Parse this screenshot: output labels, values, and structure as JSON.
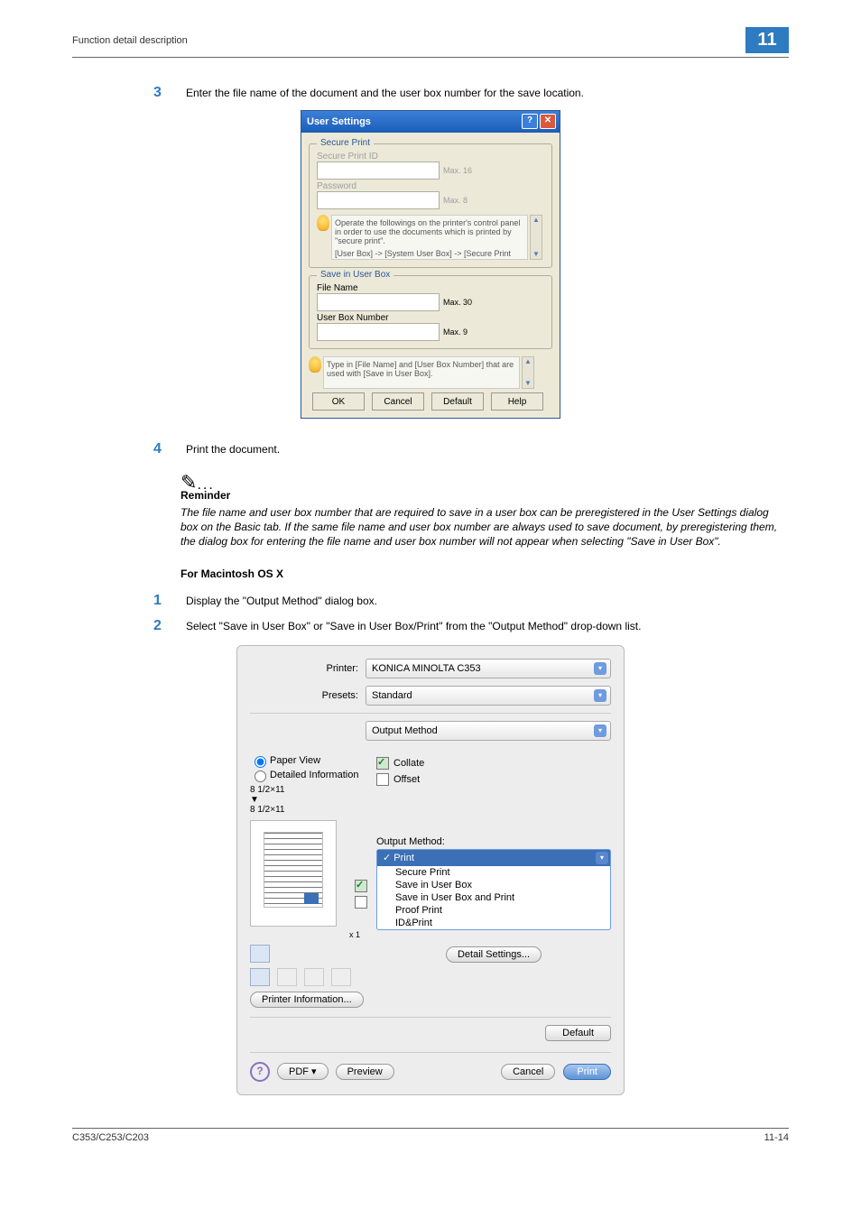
{
  "header": {
    "title": "Function detail description",
    "chapter": "11"
  },
  "steps": {
    "s3": {
      "num": "3",
      "text": "Enter the file name of the document and the user box number for the save location."
    },
    "s4": {
      "num": "4",
      "text": "Print the document."
    },
    "m1": {
      "num": "1",
      "text": "Display the \"Output Method\" dialog box."
    },
    "m2": {
      "num": "2",
      "text": "Select \"Save in User Box\" or \"Save in User Box/Print\" from the \"Output Method\" drop-down list."
    }
  },
  "win_dialog": {
    "title": "User Settings",
    "secure_group": "Secure Print",
    "secure_id_label": "Secure Print ID",
    "secure_id_hint": "Max. 16",
    "password_label": "Password",
    "password_hint": "Max. 8",
    "info1_line1": "Operate the followings on the printer's control panel in order to use the documents which is printed by \"secure print\".",
    "info1_line2": "[User Box] -> [System User Box] -> [Secure Print",
    "save_group": "Save in User Box",
    "file_name_label": "File Name",
    "file_name_hint": "Max. 30",
    "box_num_label": "User Box Number",
    "box_num_hint": "Max. 9",
    "info2": "Type in [File Name] and [User Box Number] that are used with [Save in User Box].",
    "buttons": {
      "ok": "OK",
      "cancel": "Cancel",
      "default": "Default",
      "help": "Help"
    }
  },
  "reminder": {
    "heading": "Reminder",
    "body": "The file name and user box number that are required to save in a user box can be preregistered in the User Settings dialog box on the Basic tab. If the same file name and user box number are always used to save document, by preregistering them, the dialog box for entering the file name and user box number will not appear when selecting \"Save in User Box\"."
  },
  "mac_heading": "For Macintosh OS X",
  "mac": {
    "printer_label": "Printer:",
    "printer_value": "KONICA MINOLTA C353",
    "presets_label": "Presets:",
    "presets_value": "Standard",
    "panel_value": "Output Method",
    "paper_view": "Paper View",
    "detailed_info": "Detailed Information",
    "paper_size_a": "8 1/2×11",
    "paper_size_b": "8 1/2×11",
    "x_label": "x 1",
    "collate": "Collate",
    "offset": "Offset",
    "output_method_label": "Output Method:",
    "dd_selected": "Print",
    "dd_items": [
      "Secure Print",
      "Save in User Box",
      "Save in User Box and Print",
      "Proof Print",
      "ID&Print"
    ],
    "printer_info_btn": "Printer Information...",
    "detail_btn": "Detail Settings...",
    "default_btn": "Default",
    "pdf_btn": "PDF ▾",
    "preview_btn": "Preview",
    "cancel_btn": "Cancel",
    "print_btn": "Print"
  },
  "footer": {
    "left": "C353/C253/C203",
    "right": "11-14"
  }
}
